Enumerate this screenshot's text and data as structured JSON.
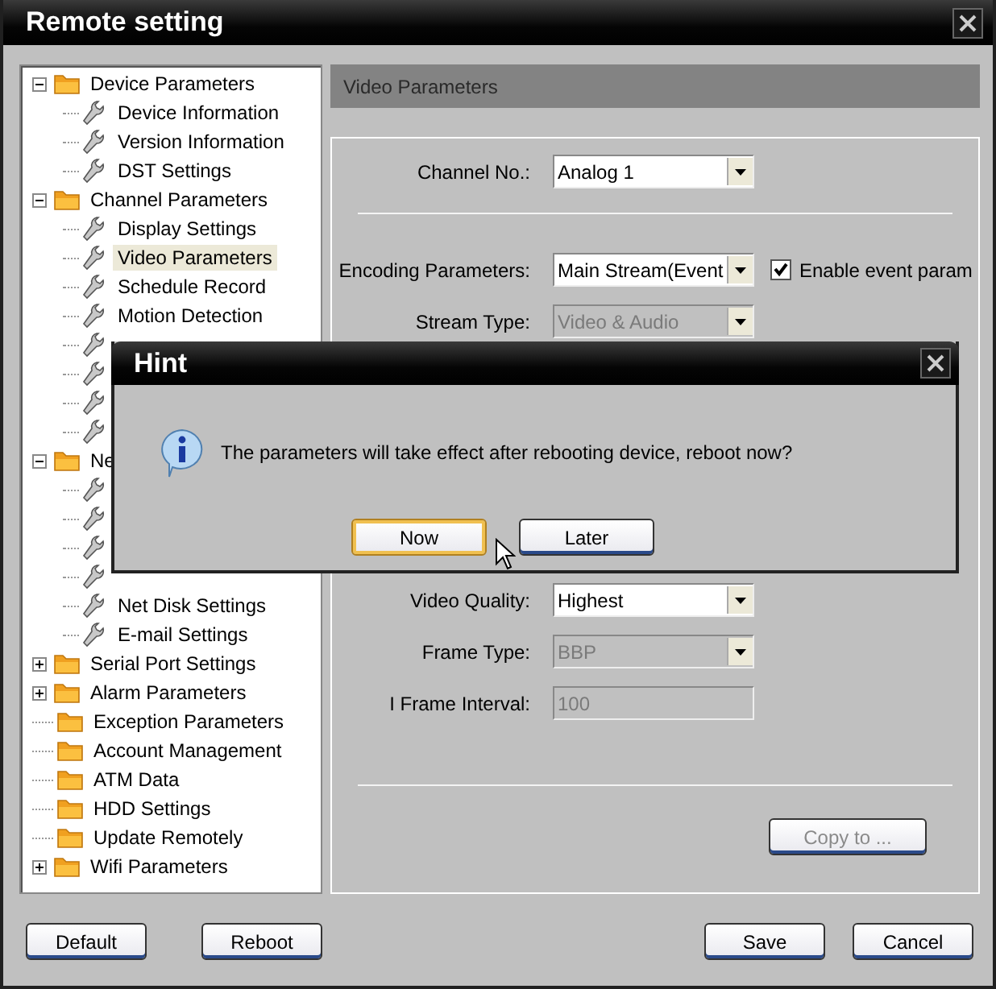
{
  "window": {
    "title": "Remote setting"
  },
  "tree": [
    {
      "label": "Device Parameters",
      "kind": "folder",
      "expanded": true,
      "children": [
        {
          "label": "Device Information",
          "kind": "setting"
        },
        {
          "label": "Version Information",
          "kind": "setting"
        },
        {
          "label": "DST Settings",
          "kind": "setting"
        }
      ]
    },
    {
      "label": "Channel Parameters",
      "kind": "folder",
      "expanded": true,
      "children": [
        {
          "label": "Display Settings",
          "kind": "setting",
          "selected": false
        },
        {
          "label": "Video Parameters",
          "kind": "setting",
          "selected": true
        },
        {
          "label": "Schedule Record",
          "kind": "setting",
          "selected": false
        },
        {
          "label": "Motion Detection",
          "kind": "setting",
          "selected": false
        },
        {
          "kind": "setting"
        },
        {
          "kind": "setting"
        },
        {
          "kind": "setting"
        },
        {
          "kind": "setting"
        }
      ]
    },
    {
      "label": "Ne",
      "kind": "folder",
      "expanded": true,
      "children": [
        {
          "kind": "setting"
        },
        {
          "kind": "setting"
        },
        {
          "kind": "setting"
        },
        {
          "kind": "setting"
        },
        {
          "label": "Net Disk Settings",
          "kind": "setting"
        },
        {
          "label": "E-mail Settings",
          "kind": "setting"
        }
      ]
    },
    {
      "label": "Serial Port Settings",
      "kind": "folder",
      "expanded": false
    },
    {
      "label": "Alarm Parameters",
      "kind": "folder",
      "expanded": false
    },
    {
      "label": "Exception Parameters",
      "kind": "folder"
    },
    {
      "label": "Account Management",
      "kind": "folder"
    },
    {
      "label": "ATM Data",
      "kind": "folder"
    },
    {
      "label": "HDD Settings",
      "kind": "folder"
    },
    {
      "label": "Update Remotely",
      "kind": "folder"
    },
    {
      "label": "Wifi Parameters",
      "kind": "folder",
      "expanded": false
    }
  ],
  "panel": {
    "title": "Video Parameters",
    "channel": {
      "label": "Channel No.:",
      "value": "Analog 1",
      "disabled": false
    },
    "encoding": {
      "label": "Encoding Parameters:",
      "value": "Main Stream(Event",
      "disabled": false,
      "checkbox": {
        "label": "Enable event param",
        "checked": true
      }
    },
    "upper_fields": [
      {
        "label": "Stream Type:",
        "value": "Video & Audio",
        "kind": "select",
        "disabled": true
      }
    ],
    "lower_fields": [
      {
        "label": "Video Quality:",
        "value": "Highest",
        "kind": "select",
        "disabled": false
      },
      {
        "label": "Frame Type:",
        "value": "BBP",
        "kind": "select",
        "disabled": true
      },
      {
        "label": "I Frame Interval:",
        "value": "100",
        "kind": "input",
        "disabled": true
      }
    ],
    "copy_button": {
      "label": "Copy to ...",
      "disabled": true
    }
  },
  "footer": {
    "left_buttons": [
      "Default",
      "Reboot"
    ],
    "right_buttons": [
      "Save",
      "Cancel"
    ]
  },
  "dialog": {
    "title": "Hint",
    "message": "The parameters will take effect after rebooting device, reboot now?",
    "buttons": [
      {
        "label": "Now",
        "focused": true
      },
      {
        "label": "Later",
        "focused": false
      }
    ]
  }
}
